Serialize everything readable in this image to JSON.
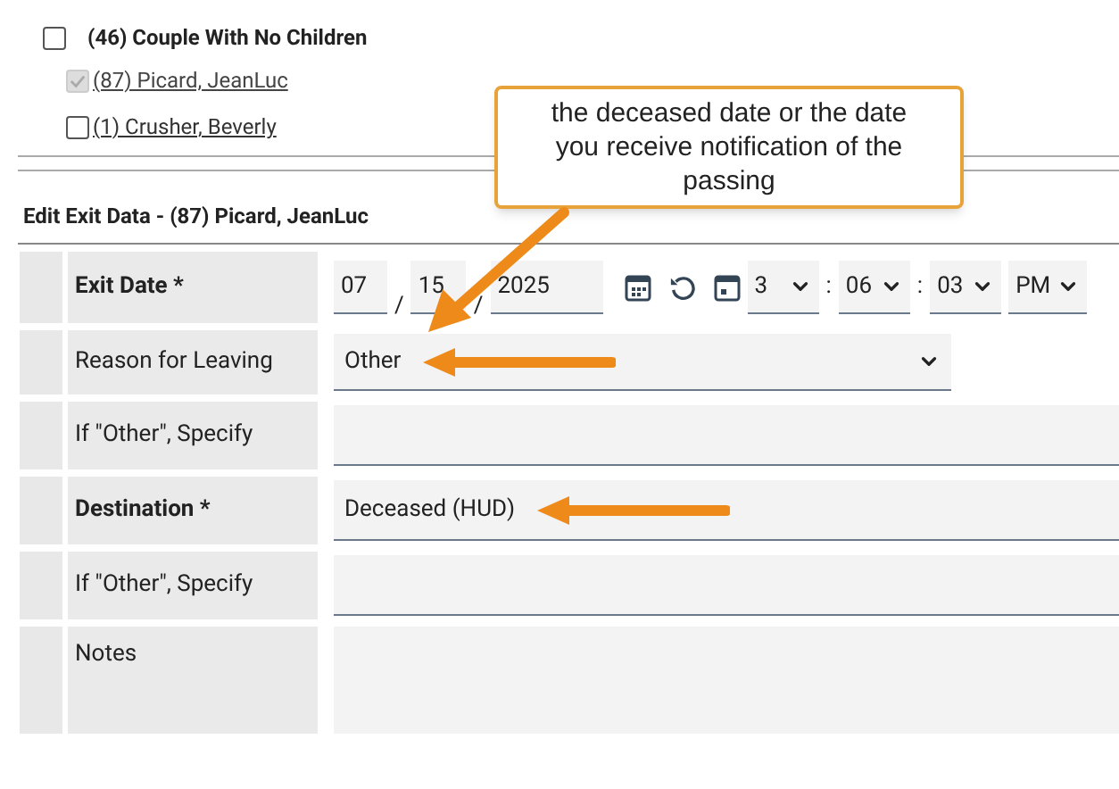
{
  "household": {
    "label": "(46) Couple With No Children",
    "checked": false
  },
  "members": [
    {
      "label": "(87) Picard, JeanLuc",
      "checked": true,
      "disabled": true
    },
    {
      "label": "(1) Crusher, Beverly",
      "checked": false,
      "disabled": false
    }
  ],
  "callout": {
    "text": "the deceased date or the date you receive notification of the passing"
  },
  "section_title": "Edit Exit Data - (87) Picard, JeanLuc",
  "fields": [
    {
      "kind": "datetime",
      "label": "Exit Date *",
      "required": true,
      "month": "07",
      "separator_1": "/",
      "day": "15",
      "separator_2": "/",
      "year": "2025",
      "hour": "3",
      "colon_1": ":",
      "minute": "06",
      "colon_2": ":",
      "second": "03",
      "ampm": "PM"
    },
    {
      "kind": "select",
      "label": "Reason for Leaving",
      "required": false,
      "value": "Other",
      "arrow": true
    },
    {
      "kind": "text",
      "label": "If \"Other\", Specify",
      "required": false
    },
    {
      "kind": "text",
      "label": "Destination *",
      "required": true,
      "value": "Deceased (HUD)",
      "arrow": true
    },
    {
      "kind": "text",
      "label": "If \"Other\", Specify",
      "required": false
    },
    {
      "kind": "textarea",
      "label": "Notes",
      "required": false
    }
  ]
}
